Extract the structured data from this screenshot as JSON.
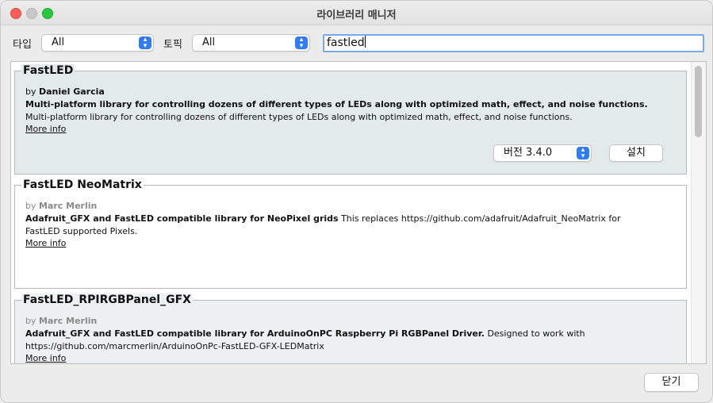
{
  "window": {
    "title": "라이브러리 매니저"
  },
  "filters": {
    "type_label": "타입",
    "type_value": "All",
    "topic_label": "토픽",
    "topic_value": "All",
    "search_value": "fastled"
  },
  "libraries": [
    {
      "name": "FastLED",
      "by": "by",
      "author": "Daniel Garcia",
      "sentence": "Multi-platform library for controlling dozens of different types of LEDs along with optimized math, effect, and noise functions.",
      "paragraph": "Multi-platform library for controlling dozens of different types of LEDs along with optimized math, effect, and noise functions.",
      "more_info": "More info",
      "version_label": "버전 3.4.0",
      "install_label": "설치",
      "selected": true
    },
    {
      "name": "FastLED NeoMatrix",
      "by": "by",
      "author": "Marc Merlin",
      "sentence": "Adafruit_GFX and FastLED compatible library for NeoPixel grids",
      "paragraph_line1": "This replaces https://github.com/adafruit/Adafruit_NeoMatrix for",
      "paragraph_line2": "FastLED supported Pixels.",
      "more_info": "More info"
    },
    {
      "name": "FastLED_RPIRGBPanel_GFX",
      "by": "by",
      "author": "Marc Merlin",
      "sentence": "Adafruit_GFX and FastLED compatible library for ArduinoOnPC Raspberry Pi RGBPanel Driver.",
      "paragraph_line1": "Designed to work with",
      "paragraph_line2": "https://github.com/marcmerlin/ArduinoOnPc-FastLED-GFX-LEDMatrix",
      "more_info": "More info"
    }
  ],
  "footer": {
    "close_label": "닫기"
  },
  "colors": {
    "selected_bg": "#e3eaea",
    "alt_bg": "#eef1f1",
    "stepper_blue": "#2f7cf6",
    "link": "#1a4fd6"
  }
}
